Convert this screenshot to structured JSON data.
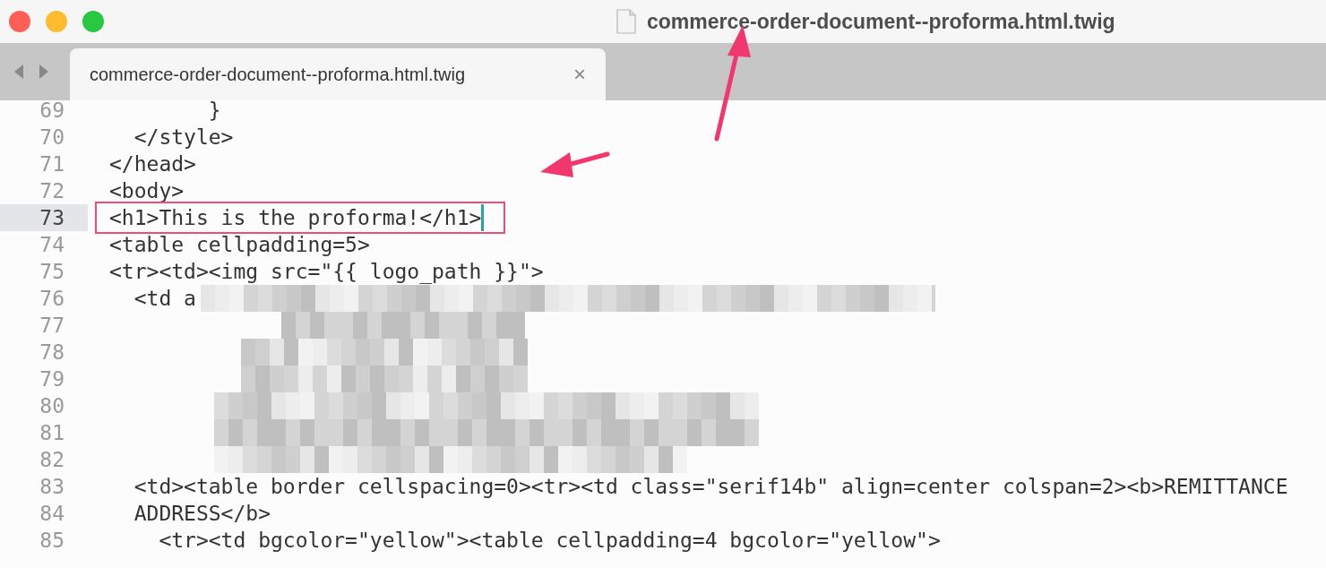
{
  "window": {
    "title": "commerce-order-document--proforma.html.twig"
  },
  "tabs": [
    {
      "label": "commerce-order-document--proforma.html.twig",
      "close": "×",
      "selected": true
    }
  ],
  "editor": {
    "lines": [
      {
        "number": "69",
        "text": "        }",
        "current": false,
        "boxed": false,
        "cursor": false
      },
      {
        "number": "70",
        "text": "  </style>",
        "current": false,
        "boxed": false,
        "cursor": false
      },
      {
        "number": "71",
        "text": "</head>",
        "current": false,
        "boxed": false,
        "cursor": false
      },
      {
        "number": "72",
        "text": "<body>",
        "current": false,
        "boxed": false,
        "cursor": false
      },
      {
        "number": "73",
        "text": "<h1>This is the proforma!</h1>",
        "current": true,
        "boxed": true,
        "cursor": true
      },
      {
        "number": "74",
        "text": "<table cellpadding=5>",
        "current": false,
        "boxed": false,
        "cursor": false
      },
      {
        "number": "75",
        "text": "<tr><td><img src=\"{{ logo_path }}\">",
        "current": false,
        "boxed": false,
        "cursor": false
      },
      {
        "number": "76",
        "text": "  <td a",
        "current": false,
        "boxed": false,
        "cursor": false
      },
      {
        "number": "77",
        "current": false,
        "boxed": false,
        "cursor": false
      },
      {
        "number": "78",
        "current": false,
        "boxed": false,
        "cursor": false
      },
      {
        "number": "79",
        "current": false,
        "boxed": false,
        "cursor": false
      },
      {
        "number": "80",
        "current": false,
        "boxed": false,
        "cursor": false
      },
      {
        "number": "81",
        "current": false,
        "boxed": false,
        "cursor": false
      },
      {
        "number": "82",
        "current": false,
        "boxed": false,
        "cursor": false
      },
      {
        "number": "83",
        "text": "  <td><table border cellspacing=0><tr><td class=\"serif14b\" align=center colspan=2><b>REMITTANCE",
        "current": false,
        "boxed": false,
        "cursor": false
      },
      {
        "number": "84",
        "text": "  ADDRESS</b>",
        "current": false,
        "boxed": false,
        "cursor": false
      },
      {
        "number": "85",
        "text": "    <tr><td bgcolor=\"yellow\"><table cellpadding=4 bgcolor=\"yellow\">",
        "current": false,
        "boxed": false,
        "cursor": false
      }
    ]
  }
}
